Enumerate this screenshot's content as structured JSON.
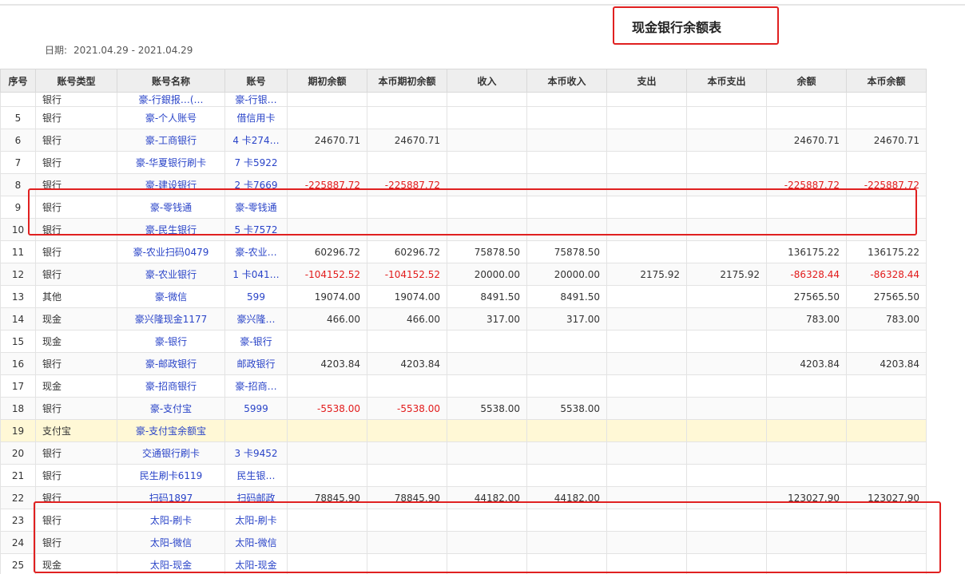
{
  "title": "现金银行余额表",
  "date": {
    "label": "日期:",
    "value": "2021.04.29 - 2021.04.29"
  },
  "columns": [
    "序号",
    "账号类型",
    "账号名称",
    "账号",
    "期初余额",
    "本币期初余额",
    "收入",
    "本币收入",
    "支出",
    "本币支出",
    "余额",
    "本币余额"
  ],
  "partial_row": [
    "",
    "银行",
    "豪-行銀报…(…",
    "豪-行银…",
    "",
    "",
    "",
    "",
    "",
    "",
    "",
    ""
  ],
  "rows": [
    [
      "5",
      "银行",
      "豪-个人账号",
      "借信用卡",
      "",
      "",
      "",
      "",
      "",
      "",
      "",
      ""
    ],
    [
      "6",
      "银行",
      "豪-工商银行",
      "4 卡274…",
      "24670.71",
      "24670.71",
      "",
      "",
      "",
      "",
      "24670.71",
      "24670.71"
    ],
    [
      "7",
      "银行",
      "豪-华夏银行刷卡",
      "7 卡5922",
      "",
      "",
      "",
      "",
      "",
      "",
      "",
      ""
    ],
    [
      "8",
      "银行",
      "豪-建设银行",
      "2 卡7669",
      "-225887.72",
      "-225887.72",
      "",
      "",
      "",
      "",
      "-225887.72",
      "-225887.72"
    ],
    [
      "9",
      "银行",
      "豪-零钱通",
      "豪-零钱通",
      "",
      "",
      "",
      "",
      "",
      "",
      "",
      ""
    ],
    [
      "10",
      "银行",
      "豪-民生银行",
      "5 卡7572",
      "",
      "",
      "",
      "",
      "",
      "",
      "",
      ""
    ],
    [
      "11",
      "银行",
      "豪-农业扫码0479",
      "豪-农业…",
      "60296.72",
      "60296.72",
      "75878.50",
      "75878.50",
      "",
      "",
      "136175.22",
      "136175.22"
    ],
    [
      "12",
      "银行",
      "豪-农业银行",
      "1 卡041…",
      "-104152.52",
      "-104152.52",
      "20000.00",
      "20000.00",
      "2175.92",
      "2175.92",
      "-86328.44",
      "-86328.44"
    ],
    [
      "13",
      "其他",
      "豪-微信",
      "599",
      "19074.00",
      "19074.00",
      "8491.50",
      "8491.50",
      "",
      "",
      "27565.50",
      "27565.50"
    ],
    [
      "14",
      "现金",
      "豪兴隆现金1177",
      "豪兴隆…",
      "466.00",
      "466.00",
      "317.00",
      "317.00",
      "",
      "",
      "783.00",
      "783.00"
    ],
    [
      "15",
      "现金",
      "豪-银行",
      "豪-银行",
      "",
      "",
      "",
      "",
      "",
      "",
      "",
      ""
    ],
    [
      "16",
      "银行",
      "豪-邮政银行",
      "邮政银行",
      "4203.84",
      "4203.84",
      "",
      "",
      "",
      "",
      "4203.84",
      "4203.84"
    ],
    [
      "17",
      "现金",
      "豪-招商银行",
      "豪-招商…",
      "",
      "",
      "",
      "",
      "",
      "",
      "",
      ""
    ],
    [
      "18",
      "银行",
      "豪-支付宝",
      "5999",
      "-5538.00",
      "-5538.00",
      "5538.00",
      "5538.00",
      "",
      "",
      "",
      ""
    ],
    [
      "19",
      "支付宝",
      "豪-支付宝余额宝",
      "",
      "",
      "",
      "",
      "",
      "",
      "",
      "",
      ""
    ],
    [
      "20",
      "银行",
      "交通银行刷卡",
      "3 卡9452",
      "",
      "",
      "",
      "",
      "",
      "",
      "",
      ""
    ],
    [
      "21",
      "银行",
      "民生刷卡6119",
      "民生银…",
      "",
      "",
      "",
      "",
      "",
      "",
      "",
      ""
    ],
    [
      "22",
      "银行",
      "扫码1897",
      "扫码邮政",
      "78845.90",
      "78845.90",
      "44182.00",
      "44182.00",
      "",
      "",
      "123027.90",
      "123027.90"
    ],
    [
      "23",
      "银行",
      "太阳-刷卡",
      "太阳-刷卡",
      "",
      "",
      "",
      "",
      "",
      "",
      "",
      ""
    ],
    [
      "24",
      "银行",
      "太阳-微信",
      "太阳-微信",
      "",
      "",
      "",
      "",
      "",
      "",
      "",
      ""
    ],
    [
      "25",
      "现金",
      "太阳-现金",
      "太阳-现金",
      "",
      "",
      "",
      "",
      "",
      "",
      "",
      ""
    ]
  ],
  "highlighted_row": "19",
  "colors": {
    "accent_red": "#e02020",
    "link_blue": "#2a44c8",
    "negative_red": "#e21b1b",
    "highlight_row": "#fff8d6",
    "header_bg": "#eeeeee"
  }
}
